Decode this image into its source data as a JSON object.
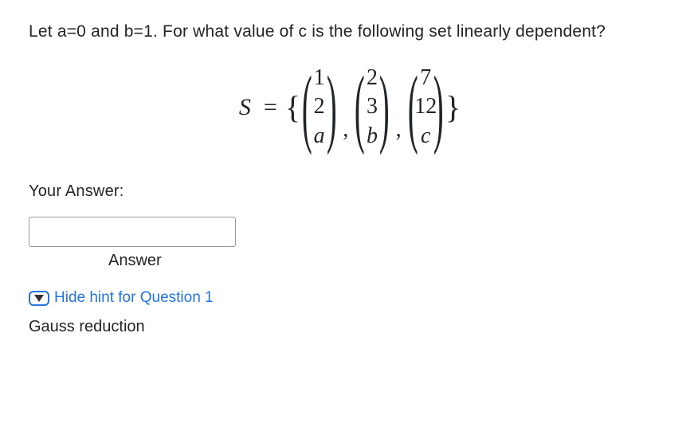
{
  "question": {
    "prompt": "Let a=0 and b=1. For what value of c is the following set linearly dependent?",
    "set_label": "S",
    "vectors": [
      {
        "r1": "1",
        "r2": "2",
        "r3": "a",
        "r3_italic": true
      },
      {
        "r1": "2",
        "r2": "3",
        "r3": "b",
        "r3_italic": true
      },
      {
        "r1": "7",
        "r2": "12",
        "r3": "c",
        "r3_italic": true
      }
    ]
  },
  "answer_section": {
    "your_answer_label": "Your Answer:",
    "answer_caption": "Answer",
    "input_value": ""
  },
  "hint": {
    "toggle_label": "Hide hint for Question 1",
    "content": "Gauss reduction"
  }
}
